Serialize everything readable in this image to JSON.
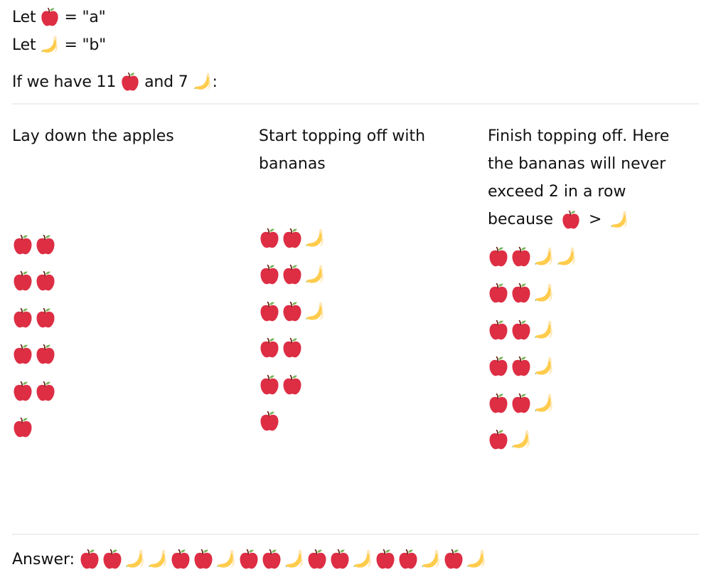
{
  "definitions": [
    {
      "prefix": "Let",
      "symbol": "apple",
      "suffix": "= \"a\""
    },
    {
      "prefix": "Let",
      "symbol": "banana",
      "suffix": "= \"b\""
    }
  ],
  "premise": {
    "part1": "If we have 11",
    "symbol1": "apple",
    "part2": "and 7",
    "symbol2": "banana",
    "part3": ":"
  },
  "counts": {
    "apple": 11,
    "banana": 7
  },
  "colors": {
    "apple_red": "#DD2E44",
    "apple_leaf": "#77B255",
    "apple_stem": "#662113",
    "banana_yellow": "#FFCC4D",
    "banana_peel": "#FFE8B6",
    "divider": "#EEEEEE",
    "text": "#111111"
  },
  "columns": [
    {
      "title": "Lay down the apples",
      "rows": [
        [
          "apple",
          "apple"
        ],
        [
          "apple",
          "apple"
        ],
        [
          "apple",
          "apple"
        ],
        [
          "apple",
          "apple"
        ],
        [
          "apple",
          "apple"
        ],
        [
          "apple"
        ]
      ]
    },
    {
      "title": "Start topping off with bananas",
      "rows": [
        [
          "apple",
          "apple",
          "banana"
        ],
        [
          "apple",
          "apple",
          "banana"
        ],
        [
          "apple",
          "apple",
          "banana"
        ],
        [
          "apple",
          "apple"
        ],
        [
          "apple",
          "apple"
        ],
        [
          "apple"
        ]
      ]
    },
    {
      "title": "Finish topping off. Here the bananas will never exceed 2 in a row because",
      "title_tail": {
        "symbol1": "apple",
        "op": ">",
        "symbol2": "banana"
      },
      "rows": [
        [
          "apple",
          "apple",
          "banana",
          "banana"
        ],
        [
          "apple",
          "apple",
          "banana"
        ],
        [
          "apple",
          "apple",
          "banana"
        ],
        [
          "apple",
          "apple",
          "banana"
        ],
        [
          "apple",
          "apple",
          "banana"
        ],
        [
          "apple",
          "banana"
        ]
      ]
    }
  ],
  "answer": {
    "label": "Answer:",
    "sequence": [
      "apple",
      "apple",
      "banana",
      "banana",
      "apple",
      "apple",
      "banana",
      "apple",
      "apple",
      "banana",
      "apple",
      "apple",
      "banana",
      "apple",
      "apple",
      "banana",
      "apple",
      "banana"
    ],
    "string": "aabbaabaabaabaabab"
  }
}
